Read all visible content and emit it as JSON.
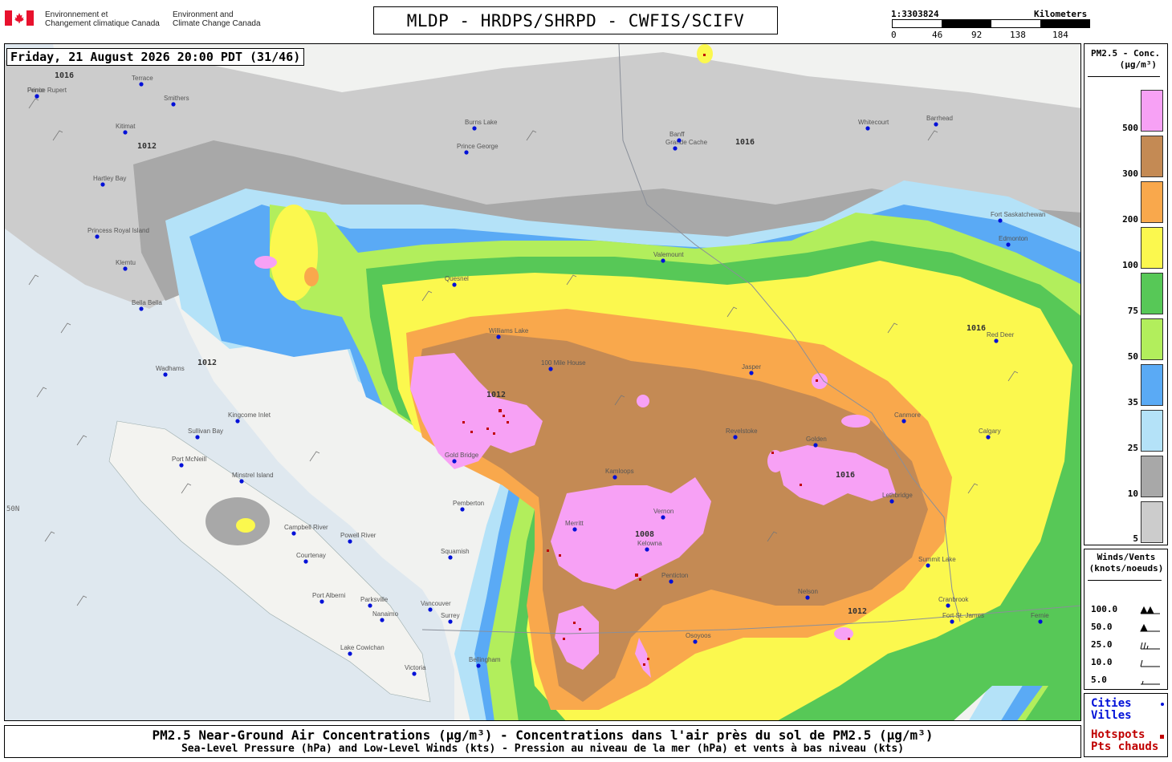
{
  "header": {
    "agency_fr": [
      "Environnement et",
      "Changement climatique Canada"
    ],
    "agency_en": [
      "Environment and",
      "Climate Change Canada"
    ],
    "title": "MLDP - HRDPS/SHRPD - CWFIS/SCIFV",
    "scale_ratio": "1:3303824",
    "scale_unit": "Kilometers",
    "scale_ticks": [
      "0",
      "46",
      "92",
      "138",
      "184"
    ]
  },
  "map": {
    "datetime": "Friday, 21 August 2026 20:00 PDT (31/46)",
    "latitude_label": "50N",
    "isobar_labels": [
      "1016",
      "1012",
      "1008"
    ],
    "cities": [
      "Prince Rupert",
      "Terrace",
      "Smithers",
      "Kitimat",
      "Hartley Bay",
      "Princess Royal Island",
      "Klemtu",
      "Bella Bella",
      "Wadhams",
      "Sullivan Bay",
      "Port McNeill",
      "Kingcome Inlet",
      "Minstrel Island",
      "Campbell River",
      "Courtenay",
      "Powell River",
      "Port Alberni",
      "Parksville",
      "Nanaimo",
      "Lake Cowichan",
      "Victoria",
      "Vancouver",
      "Surrey",
      "Bellingham",
      "Squamish",
      "Pemberton",
      "Gold Bridge",
      "Williams Lake",
      "100 Mile House",
      "Kamloops",
      "Merritt",
      "Kelowna",
      "Vernon",
      "Penticton",
      "Osoyoos",
      "Nelson",
      "Revelstoke",
      "Golden",
      "Canmore",
      "Calgary",
      "Red Deer",
      "Edmonton",
      "Fort Saskatchewan",
      "Barrhead",
      "Whitecourt",
      "Grande Cache",
      "Valemount",
      "Prince George",
      "Quesnel",
      "Burns Lake",
      "Summit Lake",
      "Cranbrook",
      "Fernie",
      "Lethbridge",
      "Banff",
      "Jasper",
      "Fort St. James",
      "Ferrie"
    ],
    "colors": {
      "c5": "#cccccc",
      "c10": "#a8a8a8",
      "c25": "#b4e2f8",
      "c35": "#5aaaf5",
      "c50": "#b2ee5c",
      "c75": "#57c857",
      "c100": "#fbf84e",
      "c200": "#f9a84c",
      "c300": "#c48a54",
      "c500": "#f7a1f5",
      "hotspot": "#c00000",
      "city": "#0010d8"
    }
  },
  "legend": {
    "title": "PM2.5 - Conc.",
    "units": "(µg/m³)",
    "levels": [
      {
        "label": "500",
        "color": "#f7a1f5"
      },
      {
        "label": "300",
        "color": "#c48a54"
      },
      {
        "label": "200",
        "color": "#f9a84c"
      },
      {
        "label": "100",
        "color": "#fbf84e"
      },
      {
        "label": "75",
        "color": "#57c857"
      },
      {
        "label": "50",
        "color": "#b2ee5c"
      },
      {
        "label": "35",
        "color": "#5aaaf5"
      },
      {
        "label": "25",
        "color": "#b4e2f8"
      },
      {
        "label": "10",
        "color": "#a8a8a8"
      },
      {
        "label": "5",
        "color": "#cccccc"
      }
    ]
  },
  "winds": {
    "title_1": "Winds/Vents",
    "title_2": "(knots/noeuds)",
    "rows": [
      "100.0",
      "50.0",
      "25.0",
      "10.0",
      "5.0"
    ]
  },
  "key": {
    "cities_1": "Cities",
    "cities_2": "Villes",
    "hotspots_1": "Hotspots",
    "hotspots_2": "Pts chauds"
  },
  "footer": {
    "line1": "PM2.5 Near-Ground Air Concentrations (µg/m³) - Concentrations dans l'air près du sol de PM2.5 (µg/m³)",
    "line2": "Sea-Level Pressure (hPa) and Low-Level Winds (kts) - Pression au niveau de la mer (hPa) et vents à bas niveau (kts)"
  }
}
